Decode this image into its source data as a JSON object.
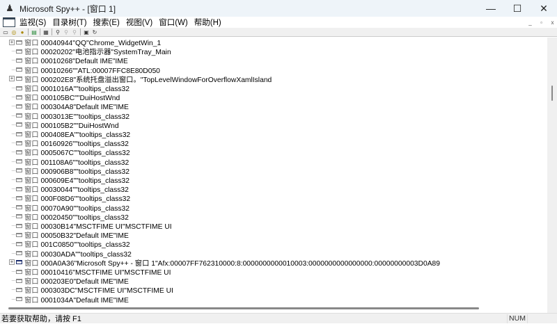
{
  "window": {
    "title": "Microsoft Spy++ - [窗口 1]",
    "minimize": "—",
    "maximize": "☐",
    "close": "✕"
  },
  "menu": [
    "监视(S)",
    "目录树(T)",
    "搜索(E)",
    "视图(V)",
    "窗口(W)",
    "帮助(H)"
  ],
  "mdi": {
    "minimize": "_",
    "restore": "▫",
    "close": "x"
  },
  "toolbar": [
    {
      "icon": "windows-icon",
      "glyph": "▭"
    },
    {
      "icon": "processes-icon",
      "glyph": "◎"
    },
    {
      "icon": "threads-icon",
      "glyph": "●"
    },
    {
      "icon": "messages-icon",
      "glyph": "▤"
    },
    {
      "icon": "log-messages-icon",
      "glyph": "▦"
    },
    {
      "icon": "find-window-icon",
      "glyph": "⚲"
    },
    {
      "icon": "find-next-icon",
      "glyph": "⚲"
    },
    {
      "icon": "find-prev-icon",
      "glyph": "⚲"
    },
    {
      "icon": "properties-icon",
      "glyph": "▣"
    },
    {
      "icon": "refresh-icon",
      "glyph": "↻"
    }
  ],
  "tree_kind": "窗口",
  "rows": [
    {
      "handle": "00040944",
      "caption": "\"QQ\"",
      "class": "Chrome_WidgetWin_1",
      "expandable": true
    },
    {
      "handle": "00020202",
      "caption": "\"电池指示器\"",
      "class": "SystemTray_Main"
    },
    {
      "handle": "00010268",
      "caption": "\"Default IME\"",
      "class": "IME"
    },
    {
      "handle": "00010266",
      "caption": "\"\"",
      "class": "ATL:00007FFC8E80D050"
    },
    {
      "handle": "000202E8",
      "caption": "\"系统托盘溢出窗口。\"",
      "class": "TopLevelWindowForOverflowXamlIsland",
      "expandable": true
    },
    {
      "handle": "0001016A",
      "caption": "\"\"",
      "class": "tooltips_class32"
    },
    {
      "handle": "000105BC",
      "caption": "\"\"",
      "class": "DuiHostWnd"
    },
    {
      "handle": "000304A8",
      "caption": "\"Default IME\"",
      "class": "IME"
    },
    {
      "handle": "0003013E",
      "caption": "\"\"",
      "class": "tooltips_class32"
    },
    {
      "handle": "000105B2",
      "caption": "\"\"",
      "class": "DuiHostWnd"
    },
    {
      "handle": "000408EA",
      "caption": "\"\"",
      "class": "tooltips_class32"
    },
    {
      "handle": "00160926",
      "caption": "\"\"",
      "class": "tooltips_class32"
    },
    {
      "handle": "0005067C",
      "caption": "\"\"",
      "class": "tooltips_class32"
    },
    {
      "handle": "001108A6",
      "caption": "\"\"",
      "class": "tooltips_class32"
    },
    {
      "handle": "000906B8",
      "caption": "\"\"",
      "class": "tooltips_class32"
    },
    {
      "handle": "000609E4",
      "caption": "\"\"",
      "class": "tooltips_class32"
    },
    {
      "handle": "00030044",
      "caption": "\"\"",
      "class": "tooltips_class32"
    },
    {
      "handle": "000F08D6",
      "caption": "\"\"",
      "class": "tooltips_class32"
    },
    {
      "handle": "00070A90",
      "caption": "\"\"",
      "class": "tooltips_class32"
    },
    {
      "handle": "00020450",
      "caption": "\"\"",
      "class": "tooltips_class32"
    },
    {
      "handle": "00030B14",
      "caption": "\"MSCTFIME UI\"",
      "class": "MSCTFIME UI"
    },
    {
      "handle": "00050B32",
      "caption": "\"Default IME\"",
      "class": "IME"
    },
    {
      "handle": "001C0850",
      "caption": "\"\"",
      "class": "tooltips_class32"
    },
    {
      "handle": "00030ADA",
      "caption": "\"\"",
      "class": "tooltips_class32"
    },
    {
      "handle": "000A0A36",
      "caption": "\"Microsoft Spy++ - 窗口 1\"",
      "class": "Afx:00007FF762310000:8:0000000000010003:0000000000000000:00000000003D0A89",
      "expandable": true,
      "dark": true
    },
    {
      "handle": "00010416",
      "caption": "\"MSCTFIME UI\"",
      "class": "MSCTFIME UI"
    },
    {
      "handle": "000203E0",
      "caption": "\"Default IME\"",
      "class": "IME"
    },
    {
      "handle": "000303DC",
      "caption": "\"MSCTFIME UI\"",
      "class": "MSCTFIME UI"
    },
    {
      "handle": "0001034A",
      "caption": "\"Default IME\"",
      "class": "IME"
    }
  ],
  "status": {
    "help": "若要获取帮助，请按 F1",
    "num": "NUM"
  }
}
